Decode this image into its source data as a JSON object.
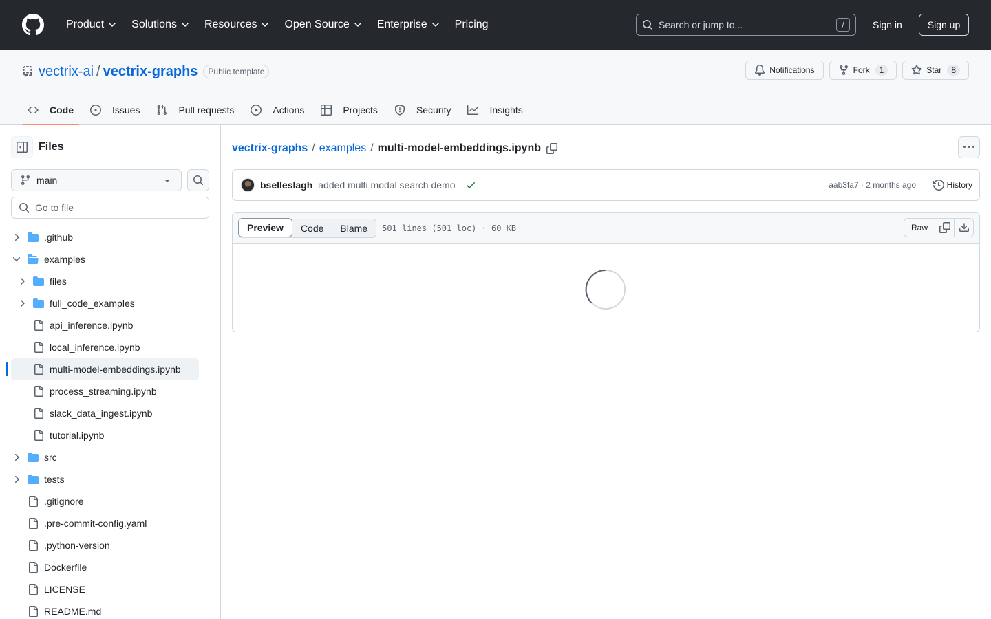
{
  "header": {
    "nav": [
      {
        "label": "Product",
        "dropdown": true
      },
      {
        "label": "Solutions",
        "dropdown": true
      },
      {
        "label": "Resources",
        "dropdown": true
      },
      {
        "label": "Open Source",
        "dropdown": true
      },
      {
        "label": "Enterprise",
        "dropdown": true
      },
      {
        "label": "Pricing",
        "dropdown": false
      }
    ],
    "search_placeholder": "Search or jump to...",
    "search_shortcut": "/",
    "sign_in": "Sign in",
    "sign_up": "Sign up"
  },
  "repo": {
    "owner": "vectrix-ai",
    "separator": "/",
    "name": "vectrix-graphs",
    "visibility": "Public template",
    "notifications": "Notifications",
    "fork_label": "Fork",
    "fork_count": "1",
    "star_label": "Star",
    "star_count": "8",
    "tabs": [
      {
        "label": "Code",
        "icon": "code-icon"
      },
      {
        "label": "Issues",
        "icon": "issue-icon"
      },
      {
        "label": "Pull requests",
        "icon": "pull-request-icon"
      },
      {
        "label": "Actions",
        "icon": "play-icon"
      },
      {
        "label": "Projects",
        "icon": "table-icon"
      },
      {
        "label": "Security",
        "icon": "shield-icon"
      },
      {
        "label": "Insights",
        "icon": "graph-icon"
      }
    ]
  },
  "sidebar": {
    "title": "Files",
    "branch": "main",
    "goto_placeholder": "Go to file",
    "tree": [
      {
        "name": ".github",
        "type": "folder",
        "expanded": false,
        "level": 0
      },
      {
        "name": "examples",
        "type": "folder",
        "expanded": true,
        "level": 0
      },
      {
        "name": "files",
        "type": "folder",
        "expanded": false,
        "level": 1
      },
      {
        "name": "full_code_examples",
        "type": "folder",
        "expanded": false,
        "level": 1
      },
      {
        "name": "api_inference.ipynb",
        "type": "file",
        "level": 1
      },
      {
        "name": "local_inference.ipynb",
        "type": "file",
        "level": 1
      },
      {
        "name": "multi-model-embeddings.ipynb",
        "type": "file",
        "level": 1,
        "selected": true
      },
      {
        "name": "process_streaming.ipynb",
        "type": "file",
        "level": 1
      },
      {
        "name": "slack_data_ingest.ipynb",
        "type": "file",
        "level": 1
      },
      {
        "name": "tutorial.ipynb",
        "type": "file",
        "level": 1
      },
      {
        "name": "src",
        "type": "folder",
        "expanded": false,
        "level": 0
      },
      {
        "name": "tests",
        "type": "folder",
        "expanded": false,
        "level": 0
      },
      {
        "name": ".gitignore",
        "type": "file",
        "level": 0
      },
      {
        "name": ".pre-commit-config.yaml",
        "type": "file",
        "level": 0
      },
      {
        "name": ".python-version",
        "type": "file",
        "level": 0
      },
      {
        "name": "Dockerfile",
        "type": "file",
        "level": 0
      },
      {
        "name": "LICENSE",
        "type": "file",
        "level": 0
      },
      {
        "name": "README.md",
        "type": "file",
        "level": 0
      }
    ]
  },
  "main": {
    "breadcrumb": {
      "repo": "vectrix-graphs",
      "sep": "/",
      "folder": "examples",
      "file": "multi-model-embeddings.ipynb"
    },
    "commit": {
      "author": "bselleslagh",
      "message": "added multi modal search demo",
      "meta": "aab3fa7 · 2 months ago",
      "history": "History"
    },
    "file": {
      "views": [
        "Preview",
        "Code",
        "Blame"
      ],
      "active_view": "Preview",
      "info": "501 lines (501 loc) · 60 KB",
      "raw": "Raw"
    }
  },
  "colors": {
    "header_bg": "#25292e",
    "link": "#0969da",
    "tab_underline": "#fd8c73",
    "folder": "#54aeff",
    "success": "#1a7f37"
  }
}
